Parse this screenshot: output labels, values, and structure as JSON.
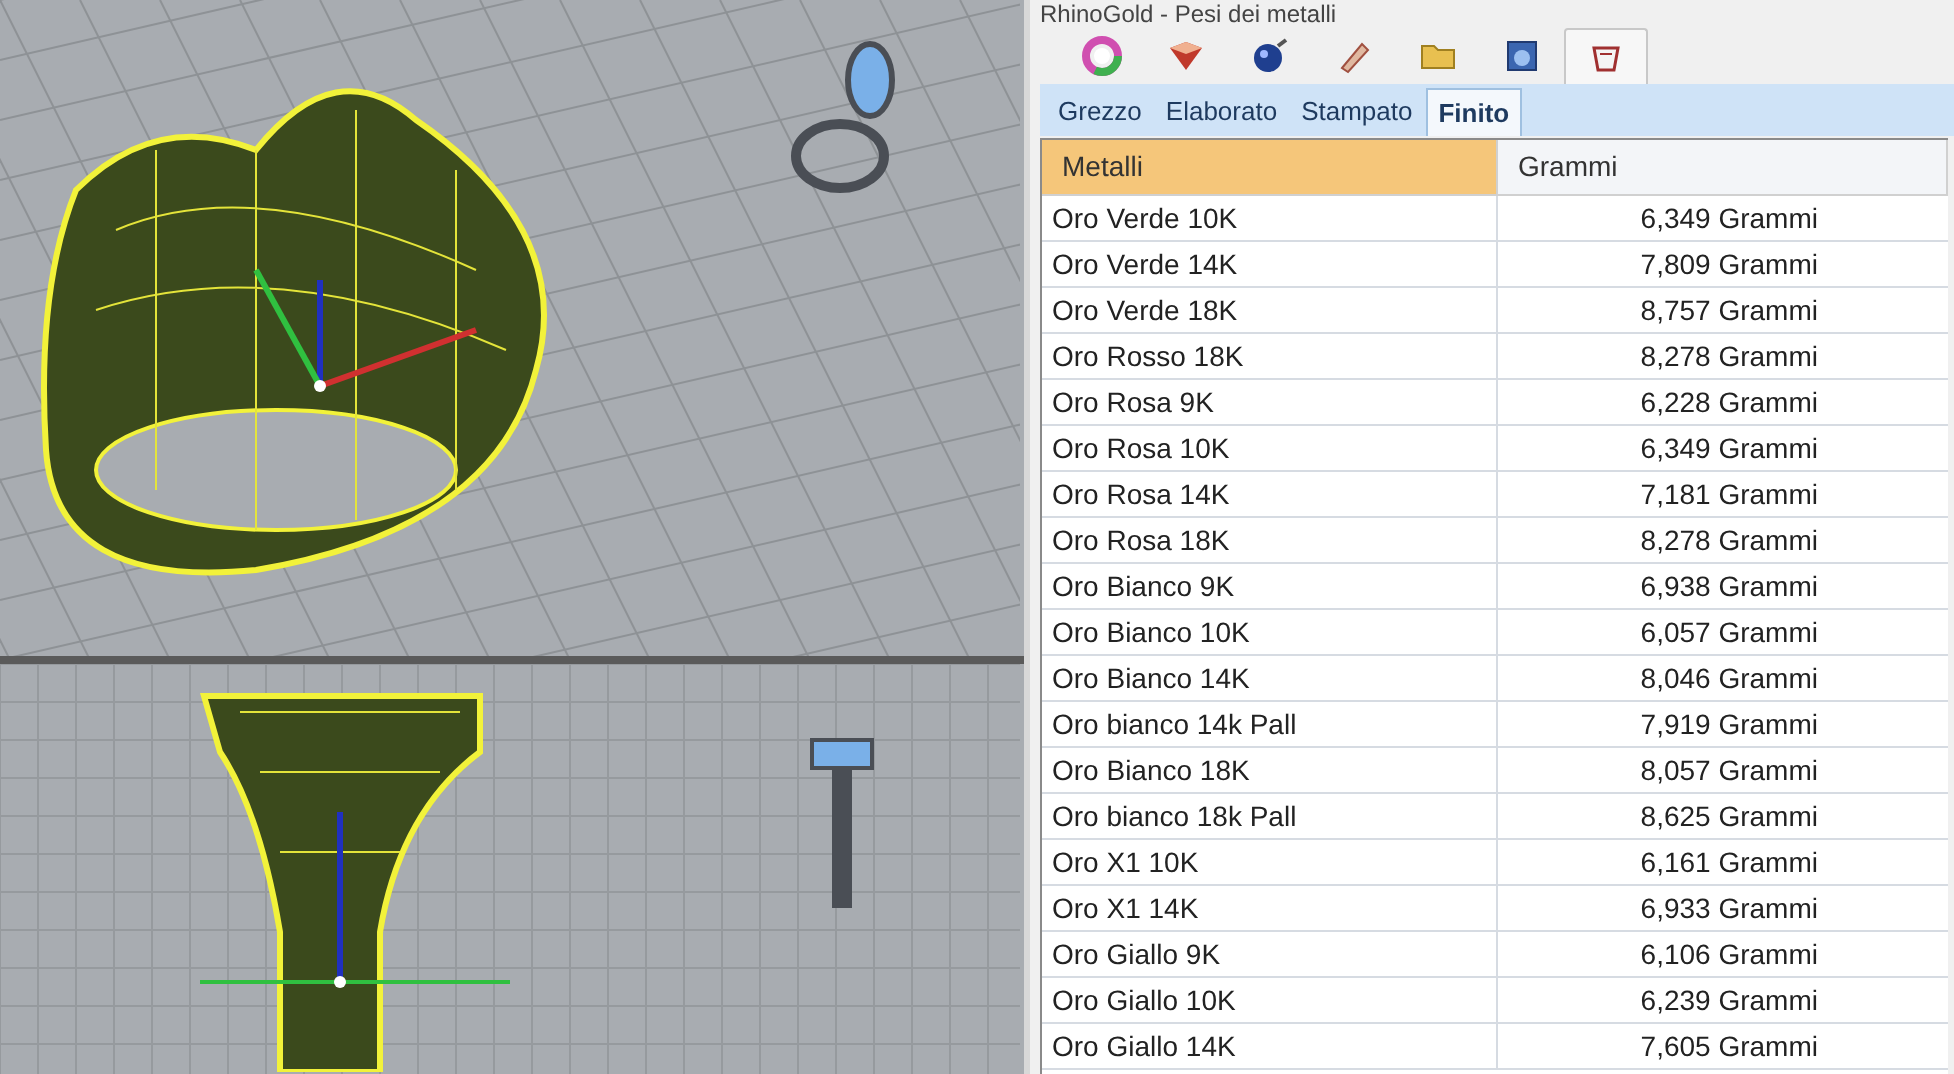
{
  "panel": {
    "title": "RhinoGold - Pesi dei metalli"
  },
  "toolbar_buttons": [
    {
      "selected": false
    },
    {
      "selected": false
    },
    {
      "selected": false
    },
    {
      "selected": false
    },
    {
      "selected": false
    },
    {
      "selected": false
    },
    {
      "selected": true
    }
  ],
  "tabs": [
    {
      "label": "Grezzo",
      "selected": false
    },
    {
      "label": "Elaborato",
      "selected": false
    },
    {
      "label": "Stampato",
      "selected": false
    },
    {
      "label": "Finito",
      "selected": true
    }
  ],
  "table": {
    "columns": [
      {
        "label": "Metalli",
        "selected": true
      },
      {
        "label": "Grammi",
        "selected": false
      }
    ],
    "rows": [
      [
        "Oro Verde 10K",
        "6,349 Grammi"
      ],
      [
        "Oro Verde 14K",
        "7,809 Grammi"
      ],
      [
        "Oro Verde 18K",
        "8,757 Grammi"
      ],
      [
        "Oro Rosso 18K",
        "8,278 Grammi"
      ],
      [
        "Oro Rosa 9K",
        "6,228 Grammi"
      ],
      [
        "Oro Rosa 10K",
        "6,349 Grammi"
      ],
      [
        "Oro Rosa 14K",
        "7,181 Grammi"
      ],
      [
        "Oro Rosa 18K",
        "8,278 Grammi"
      ],
      [
        "Oro Bianco 9K",
        "6,938 Grammi"
      ],
      [
        "Oro Bianco 10K",
        "6,057 Grammi"
      ],
      [
        "Oro Bianco 14K",
        "8,046 Grammi"
      ],
      [
        "Oro bianco 14k Pall",
        "7,919 Grammi"
      ],
      [
        "Oro Bianco 18K",
        "8,057 Grammi"
      ],
      [
        "Oro bianco 18k Pall",
        "8,625 Grammi"
      ],
      [
        "Oro X1 10K",
        "6,161 Grammi"
      ],
      [
        "Oro X1 14K",
        "6,933 Grammi"
      ],
      [
        "Oro Giallo 9K",
        "6,106 Grammi"
      ],
      [
        "Oro Giallo 10K",
        "6,239 Grammi"
      ],
      [
        "Oro Giallo 14K",
        "7,605 Grammi"
      ]
    ]
  }
}
